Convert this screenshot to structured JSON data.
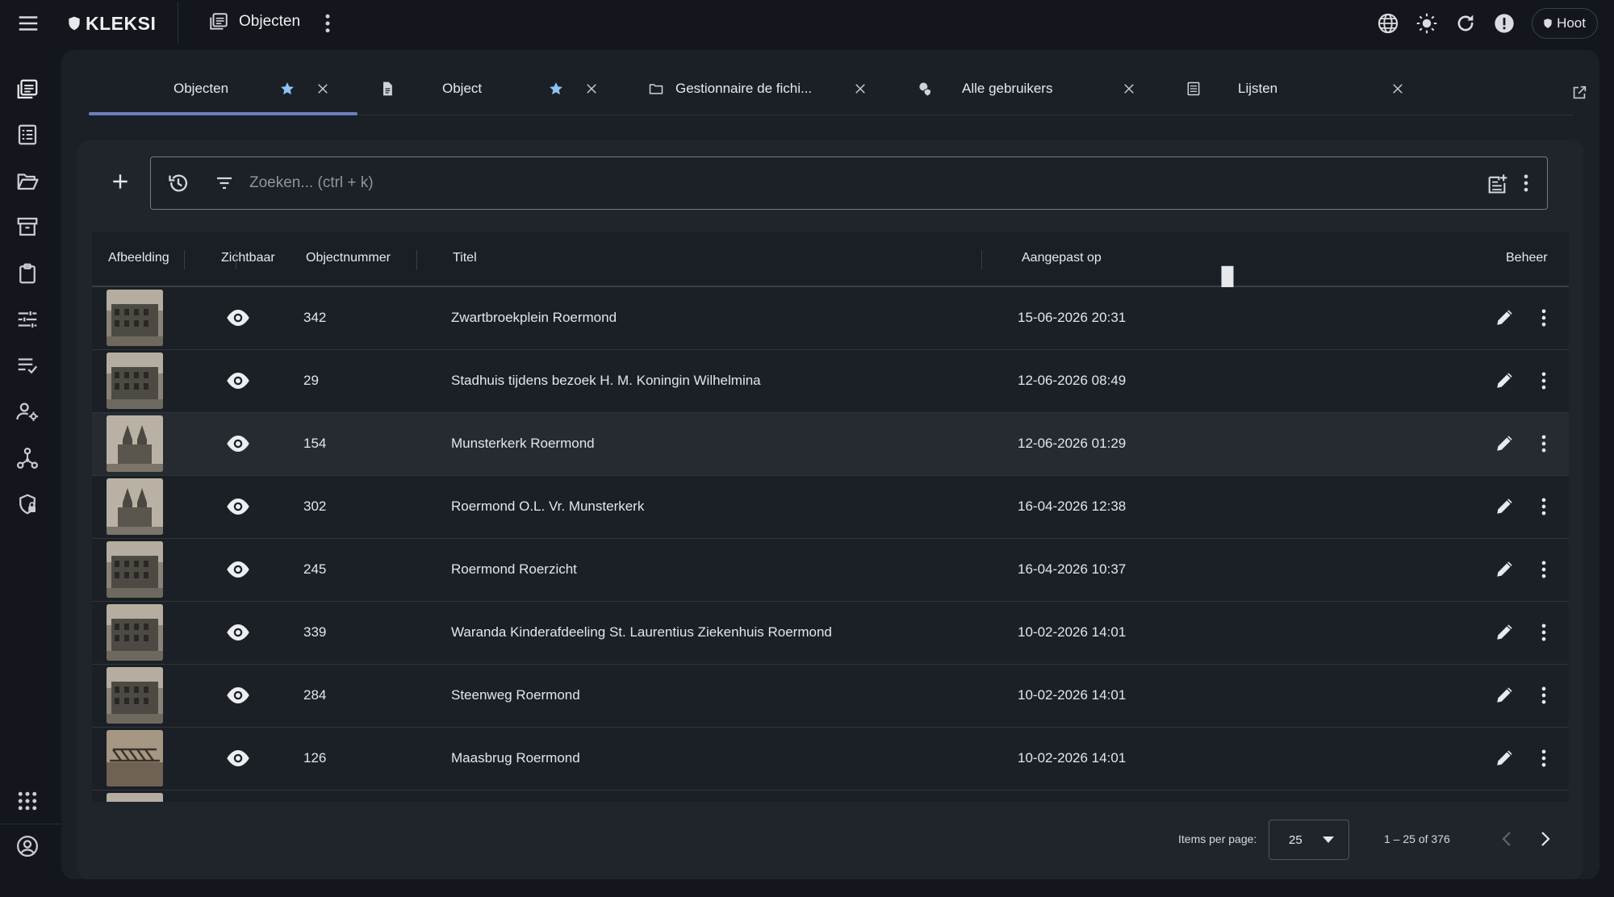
{
  "app": {
    "logo_text": "KLEKSI",
    "page_title": "Objecten",
    "user_label": "Hoot"
  },
  "icons": {
    "menu": "menu-icon",
    "globe": "globe-icon",
    "theme": "brightness-icon",
    "refresh": "refresh-icon",
    "alert": "alert-icon"
  },
  "tabs": [
    {
      "label": "Objecten",
      "icon": "none",
      "starred": true,
      "active": true
    },
    {
      "label": "Object",
      "icon": "document-icon",
      "starred": true,
      "active": false
    },
    {
      "label": "Gestionnaire de fichi...",
      "icon": "folder-icon",
      "starred": false,
      "active": false
    },
    {
      "label": "Alle gebruikers",
      "icon": "user-shield-icon",
      "starred": false,
      "active": false
    },
    {
      "label": "Lijsten",
      "icon": "list-icon",
      "starred": false,
      "active": false
    }
  ],
  "search": {
    "placeholder": "Zoeken... (ctrl + k)",
    "value": ""
  },
  "table": {
    "columns": {
      "image": "Afbeelding",
      "visible": "Zichtbaar",
      "number": "Objectnummer",
      "title": "Titel",
      "modified": "Aangepast op",
      "manage": "Beheer"
    },
    "sort": {
      "column": "modified",
      "direction": "descending"
    },
    "rows": [
      {
        "number": "342",
        "title": "Zwartbroekplein Roermond",
        "modified": "15-06-2026 20:31"
      },
      {
        "number": "29",
        "title": "Stadhuis tijdens bezoek H. M. Koningin Wilhelmina",
        "modified": "12-06-2026 08:49"
      },
      {
        "number": "154",
        "title": "Munsterkerk Roermond",
        "modified": "12-06-2026 01:29"
      },
      {
        "number": "302",
        "title": "Roermond O.L. Vr. Munsterkerk",
        "modified": "16-04-2026 12:38"
      },
      {
        "number": "245",
        "title": "Roermond Roerzicht",
        "modified": "16-04-2026 10:37"
      },
      {
        "number": "339",
        "title": "Waranda Kinderafdeeling St. Laurentius Ziekenhuis Roermond",
        "modified": "10-02-2026 14:01"
      },
      {
        "number": "284",
        "title": "Steenweg Roermond",
        "modified": "10-02-2026 14:01"
      },
      {
        "number": "126",
        "title": "Maasbrug Roermond",
        "modified": "10-02-2026 14:01"
      }
    ]
  },
  "paginator": {
    "items_per_page_label": "Items per page:",
    "items_per_page": "25",
    "range": "1 – 25 of 376"
  },
  "colors": {
    "background": "#13171d",
    "panel": "#1b2027",
    "active_tab_indicator": "#6f7dbf",
    "star": "#8ec3f5"
  }
}
